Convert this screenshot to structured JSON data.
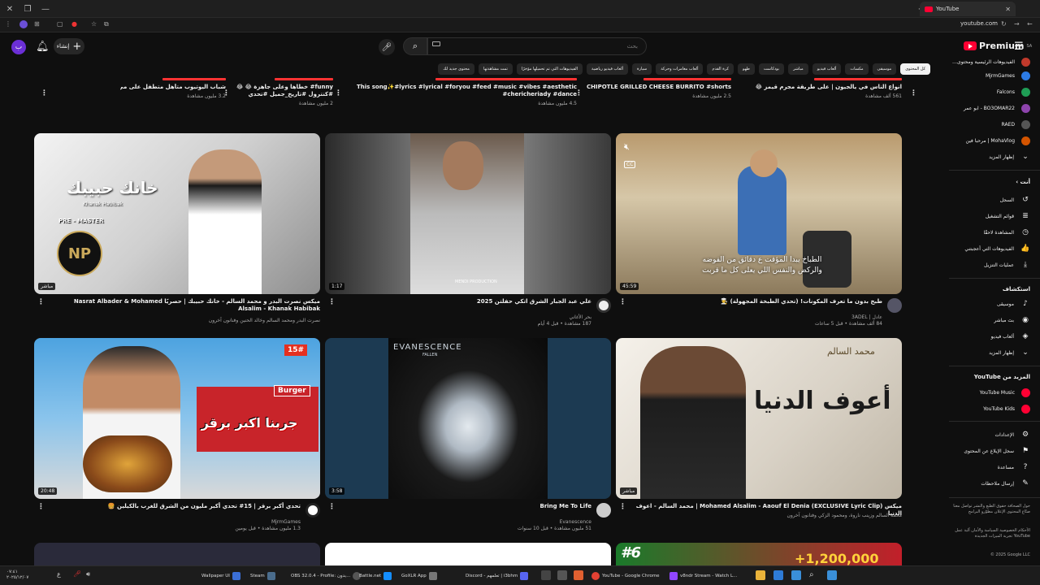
{
  "browser": {
    "tab_title": "YouTube",
    "url": "youtube.com"
  },
  "masthead": {
    "avatar_letter": "ب",
    "create_label": "إنشاء",
    "search_placeholder": "بحث",
    "logo_text": "Premium",
    "logo_badge": "SA"
  },
  "chips": [
    "كل المحتوى",
    "موسيقى",
    "مكسات",
    "ألعاب فيديو",
    "مباشر",
    "بودكاست",
    "طهو",
    "كرة القدم",
    "ألعاب مغامرات وحركة",
    "سيارة",
    "ألعاب فيديو رياضية",
    "الفيديوهات التي تم تحميلها مؤخرًا",
    "تمت مشاهدتها",
    "محتوى جديد لك"
  ],
  "top_row": [
    {
      "title": "انواع الناس في يالجيون | على طريقة مجرم قيمز 😂 😂 😂",
      "meta": "561 ألف مشاهدة"
    },
    {
      "title": "CHIPOTLE GRILLED CHEESE BURRITO #shorts",
      "meta": "2.5 مليون مشاهدة"
    },
    {
      "title": "This song✨#lyrics #lyrical #foryou #feed #music #vibes #aesthetic #chericheriady #dance",
      "meta": "4.5 مليون مشاهدة"
    },
    {
      "title": "funny# خطاها وعلى جاهزة 😂 😂 #كنترول #تاريخ_جميل #تحدي funny# automobile# #ضحك #ترند com#",
      "meta": "2 مليون مشاهدة"
    },
    {
      "title": "شباب اليوتيوب متأهل متطفل على مي 😂",
      "meta": "3.2 مليون مشاهدة"
    }
  ],
  "videos": [
    {
      "title": "طبخ بدون ما تعرف المكونات! (تحدي الطبخة المجهولة) 👨‍🍳",
      "channel": "عادل | 3ADEL",
      "meta": "84 ألف مشاهدة • قبل 5 ساعات",
      "duration": "45:59",
      "subtitle_line1": "الطباخ يبدا المؤقت ع دقائق من الفوضه",
      "subtitle_line2": "والركض والنفس اللي يعلى كل ما قربت"
    },
    {
      "title": "علي عبد الجبار الشرق اتكي حفلتن 2025",
      "channel": "بحر الأغاني",
      "meta": "187 مشاهدة • قبل 4 أيام",
      "duration": "1:17",
      "overlay": "MENDI PRODUCTION"
    },
    {
      "title": "ميكس نصرت البدر و محمد السالم - خانك حبيبك | حصريًا Nasrat Albader & Mohamed Alsalim - Khanak Habibak",
      "channel": "نصرت البدر ومحمد السالم وخالد الحنين وفنانون آخرون",
      "meta": "",
      "duration": "مباشر",
      "thumb_text": "خانك حبيبك",
      "thumb_sub": "Khanak Habibak",
      "badge": "PRE - MASTER"
    },
    {
      "title": "ميكس Mohamed Alsalim - Aaouf El Denia (EXCLUSIVE Lyric Clip) | محمد السالم - اعوف الدنيا",
      "channel": "محمد السالم وزينب ناروة، ومحمود الزكي وفنانون آخرون",
      "meta": "",
      "duration": "مباشر",
      "thumb_text": "أعوف الدنيا",
      "thumb_brand": "محمد السالم"
    },
    {
      "title": "Bring Me To Life",
      "channel": "Evanescence",
      "meta": "51 مليون مشاهدة • قبل 10 سنوات",
      "duration": "3:58",
      "thumb_brand": "EVANESCENCE",
      "thumb_sub": "FALLEN"
    },
    {
      "title": "تحدي أكبر برقر | 15# تحدي أكبر مليون من الشرق للغرب بالكيلين 🍔",
      "channel": "MjrmGames",
      "meta": "1.3 مليون مشاهدة • قبل يومين",
      "duration": "20:48",
      "thumb_text": "جربنا اكبر برقر",
      "thumb_num": "15#",
      "thumb_sign": "Burger"
    }
  ],
  "bottom_row": {
    "number": "#6",
    "amount": "+1,200,000"
  },
  "sidebar": {
    "subs": [
      {
        "name": "الفيديوهات الرئيسية ومحتوى…",
        "color": "#c0392b"
      },
      {
        "name": "MjrmGames",
        "color": "#2c7be5"
      },
      {
        "name": "Falcons",
        "color": "#1f9d55"
      },
      {
        "name": "BO3OMAR22 - ابو عمر",
        "color": "#8e44ad"
      },
      {
        "name": "RAED",
        "color": "#555555"
      },
      {
        "name": "MohaVlog | مرحبا فين",
        "color": "#d35400"
      },
      {
        "name": "إظهار المزيد",
        "color": ""
      }
    ],
    "you_head": "أنت",
    "you_items": [
      {
        "label": "السجل",
        "icon": "history-icon",
        "glyph": "↺"
      },
      {
        "label": "قوائم التشغيل",
        "icon": "playlist-icon",
        "glyph": "≣"
      },
      {
        "label": "المشاهدة لاحقًا",
        "icon": "clock-icon",
        "glyph": "◷"
      },
      {
        "label": "الفيديوهات التي أعجبتني",
        "icon": "like-icon",
        "glyph": "👍"
      },
      {
        "label": "عمليات التنزيل",
        "icon": "download-icon",
        "glyph": "⤓"
      }
    ],
    "explore_head": "استكشاف",
    "explore_items": [
      {
        "label": "موسيقى",
        "icon": "music-icon",
        "glyph": "♪"
      },
      {
        "label": "بث مباشر",
        "icon": "live-icon",
        "glyph": "◉"
      },
      {
        "label": "ألعاب فيديو",
        "icon": "gaming-icon",
        "glyph": "◈"
      },
      {
        "label": "إظهار المزيد",
        "icon": "chevron-down-icon",
        "glyph": "⌄"
      }
    ],
    "more_head": "المزيد من YouTube",
    "more_items": [
      {
        "label": "YouTube Music",
        "color": "#ff0033"
      },
      {
        "label": "YouTube Kids",
        "color": "#ff0033"
      }
    ],
    "settings_items": [
      {
        "label": "الإعدادات",
        "icon": "gear-icon",
        "glyph": "⚙"
      },
      {
        "label": "سجل الإبلاغ عن المحتوى",
        "icon": "flag-icon",
        "glyph": "⚑"
      },
      {
        "label": "مساعدة",
        "icon": "help-icon",
        "glyph": "?"
      },
      {
        "label": "إرسال ملاحظات",
        "icon": "feedback-icon",
        "glyph": "✎"
      }
    ],
    "footer1": "حول الصحافة حقوق الطبع والنشر تواصل معنا صنّاع المحتوى الإعلان مطوّرو البرامج",
    "footer2": "الأحكام الخصوصية السياسة والأمان آلية عمل YouTube تجربة الميزات الجديدة",
    "copyright": "© 2025 Google LLC"
  },
  "taskbar": {
    "apps": [
      {
        "label": "Wallpaper UI",
        "color": "#3b6fd6"
      },
      {
        "label": "Steam",
        "color": "#1b2838"
      },
      {
        "label": "OBS 32.0.4 - Profile: بدون...",
        "color": "#302e31"
      },
      {
        "label": "Battle.net",
        "color": "#148eff"
      },
      {
        "label": "GoXLR App",
        "color": "#222222"
      },
      {
        "label": "Discord - تعلمهم | i3bhm",
        "color": "#5865f2"
      },
      {
        "label": "YouTube - Google Chrome",
        "color": "#e34133"
      },
      {
        "label": "v8ndr Stream - Watch L...",
        "color": "#9146ff"
      }
    ],
    "clock_time": "٠٧:٤١",
    "clock_date": "٢٠٢٥/١٢/٠٧"
  },
  "colors": {
    "accent": "#ff0033",
    "bg": "#0f0f0f",
    "chip_bg": "#272727"
  }
}
